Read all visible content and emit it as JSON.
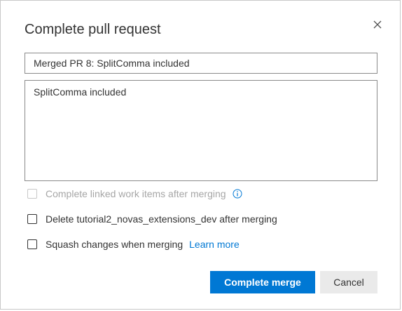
{
  "dialog": {
    "title": "Complete pull request",
    "close_icon": "close-icon"
  },
  "merge_title": {
    "value": "Merged PR 8: SplitComma included"
  },
  "merge_description": {
    "value": "SplitComma included"
  },
  "options": {
    "complete_work_items": {
      "label": "Complete linked work items after merging",
      "checked": false,
      "disabled": true,
      "icon": "info-icon"
    },
    "delete_branch": {
      "label": "Delete tutorial2_novas_extensions_dev after merging",
      "checked": false,
      "disabled": false
    },
    "squash": {
      "label": "Squash changes when merging",
      "checked": false,
      "disabled": false,
      "link_label": "Learn more"
    }
  },
  "buttons": {
    "complete_label": "Complete merge",
    "cancel_label": "Cancel"
  },
  "colors": {
    "accent": "#0078d4",
    "text": "#333333",
    "disabled_text": "#a6a6a6",
    "secondary_button": "#eaeaea"
  }
}
